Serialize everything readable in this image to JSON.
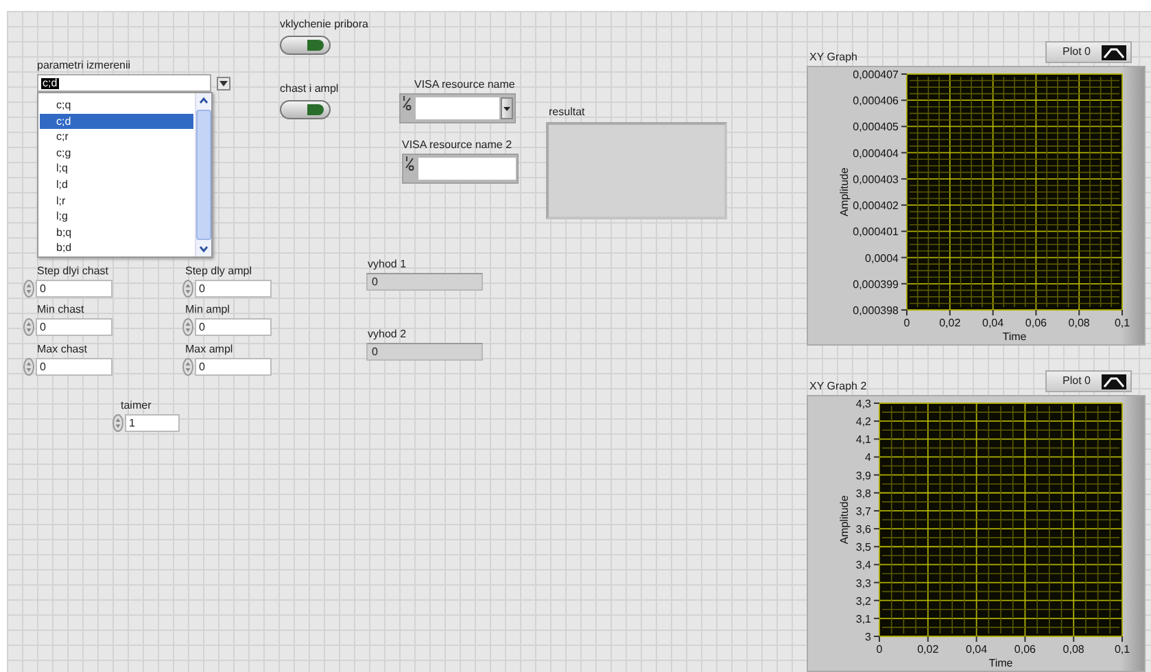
{
  "switches": [
    {
      "label": "vklychenie pribora",
      "on": false
    },
    {
      "label": "chast i ampl",
      "on": false
    }
  ],
  "ring": {
    "label": "parametri izmerenii",
    "value": "c;d",
    "expanded": true,
    "items": [
      {
        "label": "c;q",
        "selected": false
      },
      {
        "label": "c;d",
        "selected": true
      },
      {
        "label": "c;r",
        "selected": false
      },
      {
        "label": "c;g",
        "selected": false
      },
      {
        "label": "l;q",
        "selected": false
      },
      {
        "label": "l;d",
        "selected": false
      },
      {
        "label": "l;r",
        "selected": false
      },
      {
        "label": "l;g",
        "selected": false
      },
      {
        "label": "b;q",
        "selected": false
      },
      {
        "label": "b;d",
        "selected": false
      }
    ]
  },
  "numerics": [
    {
      "label": "Step dlyi chast",
      "value": "0"
    },
    {
      "label": "Min chast",
      "value": "0"
    },
    {
      "label": "Max chast",
      "value": "0"
    },
    {
      "label": "Step dly ampl",
      "value": "0"
    },
    {
      "label": "Min ampl",
      "value": "0"
    },
    {
      "label": "Max ampl",
      "value": "0"
    },
    {
      "label": "taimer",
      "value": "1"
    }
  ],
  "visa": [
    {
      "label": "VISA resource name",
      "kind": "dropdown"
    },
    {
      "label": "VISA resource name 2",
      "kind": "plain"
    }
  ],
  "indicators": [
    {
      "label": "vyhod 1",
      "value": "0"
    },
    {
      "label": "vyhod 2",
      "value": "0"
    }
  ],
  "string_indicator": {
    "label": "resultat"
  },
  "graphs": [
    {
      "label": "XY Graph",
      "legend": "Plot 0",
      "chart_data": {
        "type": "line",
        "grid": true,
        "xlabel": "Time",
        "ylabel": "Amplitude",
        "xlim": [
          0,
          0.1
        ],
        "ylim": [
          0.000398,
          0.000407
        ],
        "xticks": [
          {
            "value": 0,
            "label": "0"
          },
          {
            "value": 0.02,
            "label": "0,02"
          },
          {
            "value": 0.04,
            "label": "0,04"
          },
          {
            "value": 0.06,
            "label": "0,06"
          },
          {
            "value": 0.08,
            "label": "0,08"
          },
          {
            "value": 0.1,
            "label": "0,1"
          }
        ],
        "yticks": [
          {
            "value": 0.000398,
            "label": "0,000398"
          },
          {
            "value": 0.000399,
            "label": "0,000399"
          },
          {
            "value": 0.0004,
            "label": "0,0004"
          },
          {
            "value": 0.000401,
            "label": "0,000401"
          },
          {
            "value": 0.000402,
            "label": "0,000402"
          },
          {
            "value": 0.000403,
            "label": "0,000403"
          },
          {
            "value": 0.000404,
            "label": "0,000404"
          },
          {
            "value": 0.000405,
            "label": "0,000405"
          },
          {
            "value": 0.000406,
            "label": "0,000406"
          },
          {
            "value": 0.000407,
            "label": "0,000407"
          }
        ]
      }
    },
    {
      "label": "XY Graph 2",
      "legend": "Plot 0",
      "chart_data": {
        "type": "line",
        "grid": true,
        "xlabel": "Time",
        "ylabel": "Amplitude",
        "xlim": [
          0,
          0.1
        ],
        "ylim": [
          3,
          4.3
        ],
        "xticks": [
          {
            "value": 0,
            "label": "0"
          },
          {
            "value": 0.02,
            "label": "0,02"
          },
          {
            "value": 0.04,
            "label": "0,04"
          },
          {
            "value": 0.06,
            "label": "0,06"
          },
          {
            "value": 0.08,
            "label": "0,08"
          },
          {
            "value": 0.1,
            "label": "0,1"
          }
        ],
        "yticks": [
          {
            "value": 3,
            "label": "3"
          },
          {
            "value": 3.1,
            "label": "3,1"
          },
          {
            "value": 3.2,
            "label": "3,2"
          },
          {
            "value": 3.3,
            "label": "3,3"
          },
          {
            "value": 3.4,
            "label": "3,4"
          },
          {
            "value": 3.5,
            "label": "3,5"
          },
          {
            "value": 3.6,
            "label": "3,6"
          },
          {
            "value": 3.7,
            "label": "3,7"
          },
          {
            "value": 3.8,
            "label": "3,8"
          },
          {
            "value": 3.9,
            "label": "3,9"
          },
          {
            "value": 4,
            "label": "4"
          },
          {
            "value": 4.1,
            "label": "4,1"
          },
          {
            "value": 4.2,
            "label": "4,2"
          },
          {
            "value": 4.3,
            "label": "4,3"
          }
        ]
      }
    }
  ]
}
